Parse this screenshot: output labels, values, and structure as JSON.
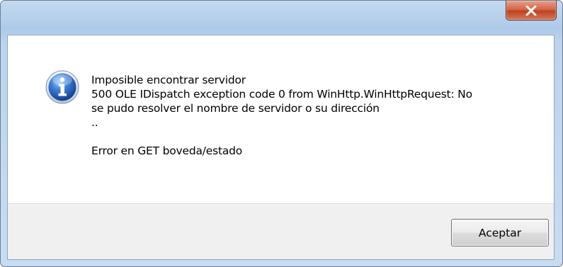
{
  "dialog": {
    "title": "",
    "icon": "info-icon",
    "close_icon": "close-icon",
    "message_lines": [
      "Imposible encontrar servidor",
      "500 OLE IDispatch exception code 0 from WinHttp.WinHttpRequest: No",
      "se pudo resolver el nombre de servidor o su dirección",
      "..",
      "",
      "Error en GET boveda/estado"
    ],
    "buttons": {
      "accept_label": "Aceptar"
    }
  },
  "colors": {
    "close_button": "#c7462a",
    "icon_blue": "#1f5fb8",
    "content_bg": "#ffffff",
    "button_bar_bg": "#f0f0f0"
  }
}
